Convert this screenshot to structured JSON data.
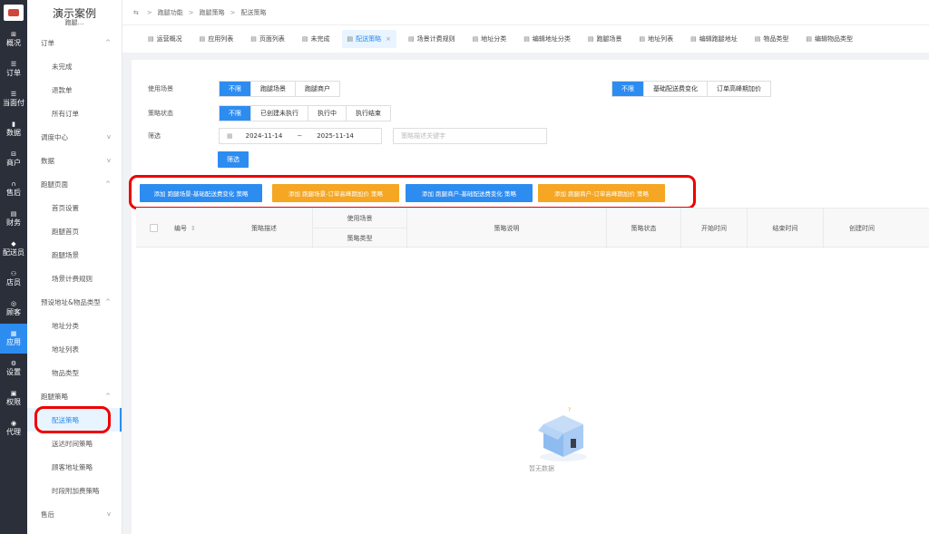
{
  "rail": [
    {
      "label": "概况",
      "icon": "grid-icon",
      "glyph": "⊞"
    },
    {
      "label": "订单",
      "icon": "list-icon",
      "glyph": "☰"
    },
    {
      "label": "当面付",
      "icon": "list-icon",
      "glyph": "☰"
    },
    {
      "label": "数据",
      "icon": "chart-icon",
      "glyph": "▮"
    },
    {
      "label": "商户",
      "icon": "shop-icon",
      "glyph": "⊟"
    },
    {
      "label": "售后",
      "icon": "headset-icon",
      "glyph": "∩"
    },
    {
      "label": "财务",
      "icon": "finance-icon",
      "glyph": "▤"
    },
    {
      "label": "配送员",
      "icon": "courier-icon",
      "glyph": "◆"
    },
    {
      "label": "店员",
      "icon": "staff-icon",
      "glyph": "⚇"
    },
    {
      "label": "顾客",
      "icon": "customer-icon",
      "glyph": "◎"
    },
    {
      "label": "应用",
      "icon": "apps-icon",
      "glyph": "▦"
    },
    {
      "label": "设置",
      "icon": "settings-icon",
      "glyph": "⚙"
    },
    {
      "label": "权限",
      "icon": "lock-icon",
      "glyph": "▣"
    },
    {
      "label": "代理",
      "icon": "agent-icon",
      "glyph": "◉"
    }
  ],
  "sidebar": {
    "title": "演示案例",
    "subtitle": "跑腿...",
    "entries": [
      {
        "type": "group",
        "label": "订单",
        "arrow": "^"
      },
      {
        "type": "item",
        "label": "未完成"
      },
      {
        "type": "item",
        "label": "退款单"
      },
      {
        "type": "item",
        "label": "所有订单"
      },
      {
        "type": "group",
        "label": "调度中心",
        "arrow": "v"
      },
      {
        "type": "group",
        "label": "数据",
        "arrow": "v"
      },
      {
        "type": "group",
        "label": "跑腿页面",
        "arrow": "^"
      },
      {
        "type": "item",
        "label": "首页设置"
      },
      {
        "type": "item",
        "label": "跑腿首页"
      },
      {
        "type": "item",
        "label": "跑腿场景"
      },
      {
        "type": "item",
        "label": "场景计费规则"
      },
      {
        "type": "group",
        "label": "预设地址&物品类型",
        "arrow": "^"
      },
      {
        "type": "item",
        "label": "地址分类"
      },
      {
        "type": "item",
        "label": "地址列表"
      },
      {
        "type": "item",
        "label": "物品类型"
      },
      {
        "type": "group",
        "label": "跑腿策略",
        "arrow": "^"
      },
      {
        "type": "item",
        "label": "配送策略",
        "active": true
      },
      {
        "type": "item",
        "label": "送达时间策略"
      },
      {
        "type": "item",
        "label": "顾客地址策略"
      },
      {
        "type": "item",
        "label": "时段附加费策略"
      },
      {
        "type": "group",
        "label": "售后",
        "arrow": "v"
      }
    ]
  },
  "breadcrumb": {
    "menu_glyph": "⇆",
    "items": [
      "跑腿功能",
      "跑腿策略",
      "配送策略"
    ],
    "separator": ">"
  },
  "tabs": [
    {
      "label": "运营概况"
    },
    {
      "label": "应用列表"
    },
    {
      "label": "页面列表"
    },
    {
      "label": "未完成"
    },
    {
      "label": "配送策略",
      "active": true,
      "close": "×"
    },
    {
      "label": "场景计费规则"
    },
    {
      "label": "地址分类"
    },
    {
      "label": "编辑地址分类"
    },
    {
      "label": "跑腿场景"
    },
    {
      "label": "地址列表"
    },
    {
      "label": "编辑跑腿地址"
    },
    {
      "label": "物品类型"
    },
    {
      "label": "编辑物品类型"
    }
  ],
  "filters": {
    "scene": {
      "label": "使用场景",
      "options": [
        "不限",
        "跑腿场景",
        "跑腿商户"
      ],
      "selected": 0
    },
    "strategy_type": {
      "options": [
        "不限",
        "基础配送费变化",
        "订单高峰期加价"
      ],
      "selected": 0
    },
    "status": {
      "label": "策略状态",
      "options": [
        "不限",
        "已创建未执行",
        "执行中",
        "执行结束"
      ],
      "selected": 0
    },
    "date": {
      "label": "筛选",
      "start": "2024-11-14",
      "tilde": "~",
      "end": "2025-11-14"
    },
    "keyword_placeholder": "策略描述关键字",
    "submit": "筛选"
  },
  "add_buttons": [
    {
      "label": "添加 跑腿场景-基础配送费变化 策略",
      "color": "#2d8cf0"
    },
    {
      "label": "添加 跑腿场景-订单高峰期加价 策略",
      "color": "#f5a623"
    },
    {
      "label": "添加 跑腿商户-基础配送费变化 策略",
      "color": "#2d8cf0"
    },
    {
      "label": "添加 跑腿商户-订单高峰期加价 策略",
      "color": "#f5a623"
    }
  ],
  "table": {
    "columns": {
      "id": "编号",
      "sort_glyph": "⇕",
      "desc": "策略描述",
      "scene": "使用场景",
      "type": "策略类型",
      "explain": "策略说明",
      "status": "策略状态",
      "start": "开始时间",
      "end": "结束时间",
      "created": "创建时间"
    },
    "empty_text": "暂无数据"
  },
  "colors": {
    "primary": "#2d8cf0",
    "warning": "#f5a623",
    "highlight": "#e00000",
    "rail": "#2b2f3a"
  }
}
